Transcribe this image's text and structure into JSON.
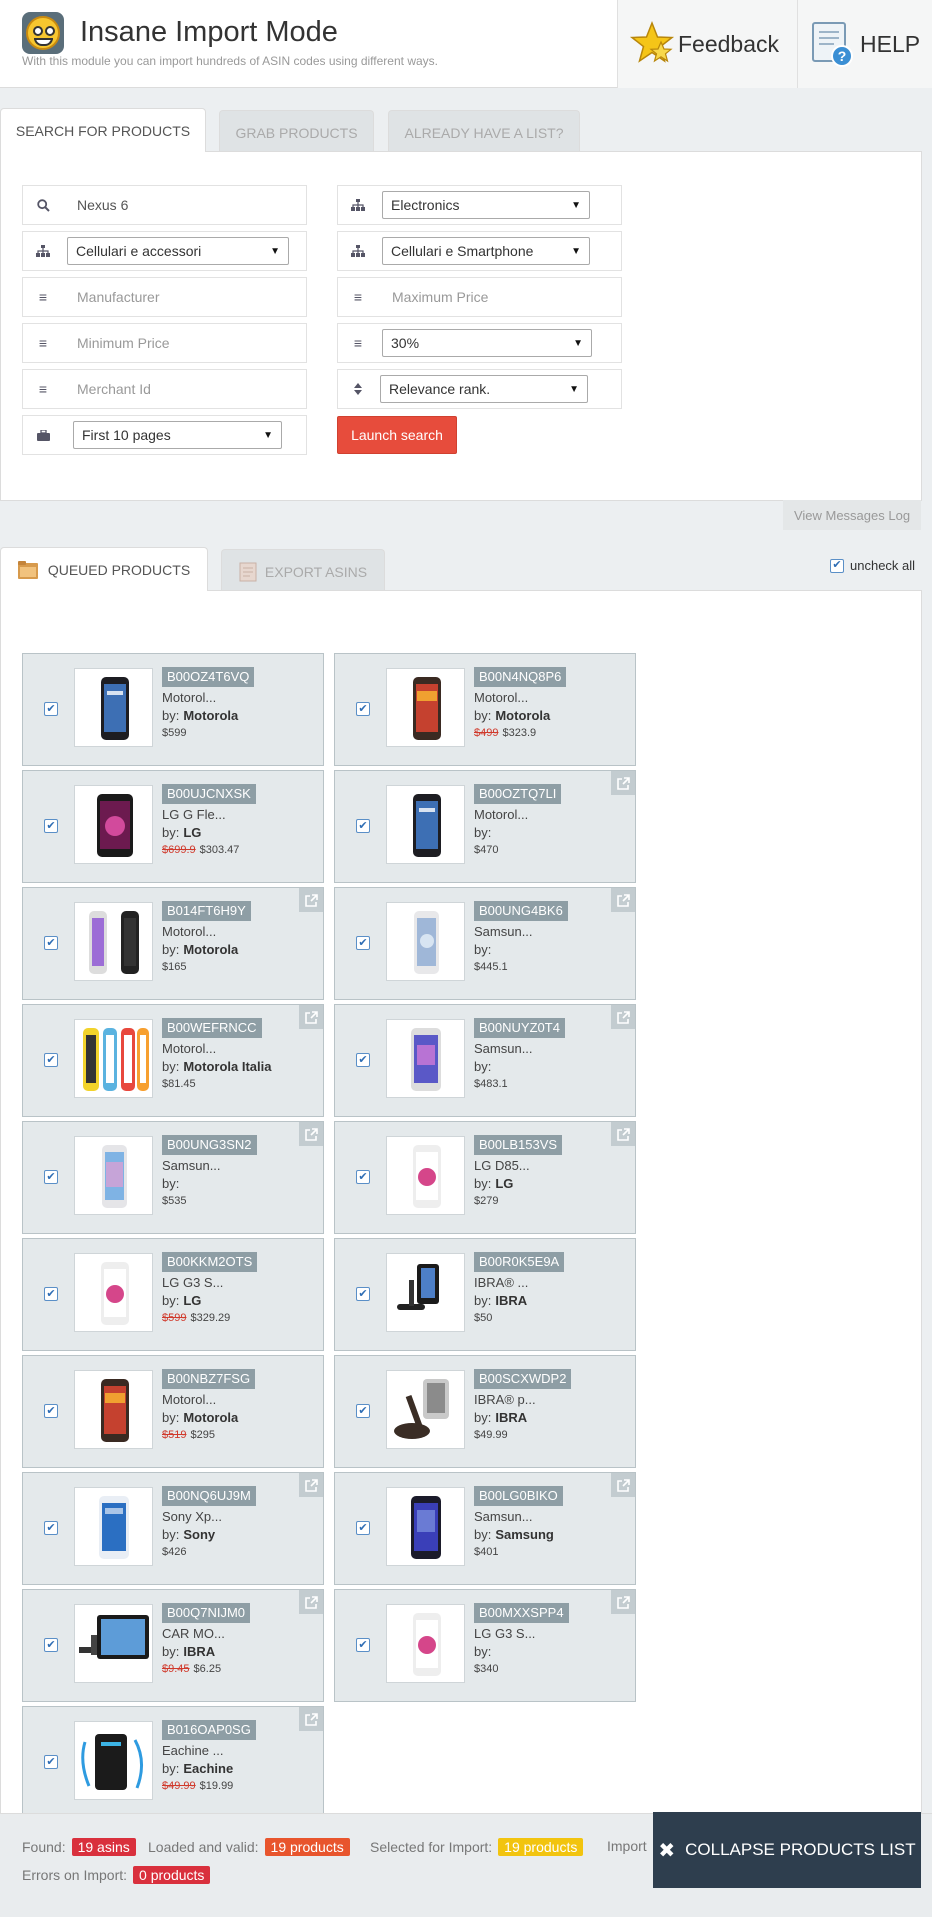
{
  "header": {
    "title": "Insane Import Mode",
    "subtitle": "With this module you can import hundreds of ASIN codes using different ways.",
    "feedback_label": "Feedback",
    "help_label": "HELP"
  },
  "search_tabs": [
    "SEARCH FOR PRODUCTS",
    "GRAB PRODUCTS",
    "ALREADY HAVE A LIST?"
  ],
  "search_form": {
    "keyword_value": "Nexus 6",
    "category_value": "Electronics",
    "subcategory1_value": "Cellulari e accessori",
    "subcategory2_value": "Cellulari e Smartphone",
    "manufacturer_placeholder": "Manufacturer",
    "max_price_placeholder": "Maximum Price",
    "min_price_placeholder": "Minimum Price",
    "discount_value": "30%",
    "merchant_placeholder": "Merchant Id",
    "sort_value": "Relevance rank.",
    "pages_value": "First 10 pages",
    "launch_label": "Launch search"
  },
  "view_messages_log": "View Messages Log",
  "products_tabs": [
    "QUEUED PRODUCTS",
    "EXPORT ASINS"
  ],
  "uncheck_all_label": "uncheck all",
  "products": [
    {
      "asin": "B00OZ4T6VQ",
      "name": "Motorol...",
      "brand": "Motorola",
      "old_price": "",
      "price": "$599",
      "img": "phone-nexus",
      "ext": false
    },
    {
      "asin": "B00N4NQ8P6",
      "name": "Motorol...",
      "brand": "Motorola",
      "old_price": "$499",
      "price": "$323.9",
      "img": "phone-moto-red",
      "ext": false
    },
    {
      "asin": "B00UJCNXSK",
      "name": "LG G Fle...",
      "brand": "LG",
      "old_price": "$699.9",
      "price": "$303.47",
      "img": "phone-lg-pink",
      "ext": false
    },
    {
      "asin": "B00OZTQ7LI",
      "name": "Motorol...",
      "brand": "",
      "old_price": "",
      "price": "$470",
      "img": "phone-nexus",
      "ext": true
    },
    {
      "asin": "B014FT6H9Y",
      "name": "Motorol...",
      "brand": "Motorola",
      "old_price": "",
      "price": "$165",
      "img": "phone-moto-pair",
      "ext": true
    },
    {
      "asin": "B00UNG4BK6",
      "name": "Samsun...",
      "brand": "",
      "old_price": "",
      "price": "$445.1",
      "img": "phone-samsung-white",
      "ext": true
    },
    {
      "asin": "B00WEFRNCC",
      "name": "Motorol...",
      "brand": "Motorola Italia",
      "old_price": "",
      "price": "$81.45",
      "img": "phone-moto-colors",
      "ext": true
    },
    {
      "asin": "B00NUYZ0T4",
      "name": "Samsun...",
      "brand": "",
      "old_price": "",
      "price": "$483.1",
      "img": "phone-samsung-note",
      "ext": true
    },
    {
      "asin": "B00UNG3SN2",
      "name": "Samsun...",
      "brand": "",
      "old_price": "",
      "price": "$535",
      "img": "phone-samsung-edge",
      "ext": true
    },
    {
      "asin": "B00LB153VS",
      "name": "LG D85...",
      "brand": "LG",
      "old_price": "",
      "price": "$279",
      "img": "phone-lg-white",
      "ext": true
    },
    {
      "asin": "B00KKM2OTS",
      "name": "LG G3 S...",
      "brand": "LG",
      "old_price": "$599",
      "price": "$329.29",
      "img": "phone-lg-white",
      "ext": false
    },
    {
      "asin": "B00R0K5E9A",
      "name": "IBRA® ...",
      "brand": "IBRA",
      "old_price": "",
      "price": "$50",
      "img": "car-holder",
      "ext": false
    },
    {
      "asin": "B00NBZ7FSG",
      "name": "Motorol...",
      "brand": "Motorola",
      "old_price": "$519",
      "price": "$295",
      "img": "phone-moto-red",
      "ext": false
    },
    {
      "asin": "B00SCXWDP2",
      "name": "IBRA® p...",
      "brand": "IBRA",
      "old_price": "",
      "price": "$49.99",
      "img": "car-holder-2",
      "ext": false
    },
    {
      "asin": "B00NQ6UJ9M",
      "name": "Sony Xp...",
      "brand": "Sony",
      "old_price": "",
      "price": "$426",
      "img": "phone-sony",
      "ext": true
    },
    {
      "asin": "B00LG0BIKO",
      "name": "Samsun...",
      "brand": "Samsung",
      "old_price": "",
      "price": "$401",
      "img": "phone-samsung-s5",
      "ext": true
    },
    {
      "asin": "B00Q7NIJM0",
      "name": "CAR MO...",
      "brand": "IBRA",
      "old_price": "$9.45",
      "price": "$6.25",
      "img": "tablet-mount",
      "ext": true
    },
    {
      "asin": "B00MXXSPP4",
      "name": "LG G3 S...",
      "brand": "",
      "old_price": "",
      "price": "$340",
      "img": "phone-lg-white",
      "ext": true
    },
    {
      "asin": "B016OAP0SG",
      "name": "Eachine ...",
      "brand": "Eachine",
      "old_price": "$49.99",
      "price": "$19.99",
      "img": "power-bank",
      "ext": true
    }
  ],
  "by_label": "by:",
  "footer": {
    "found_label": "Found:",
    "found_value": "19 asins",
    "loaded_label": "Loaded and valid:",
    "loaded_value": "19 products",
    "selected_label": "Selected for Import:",
    "selected_value": "19 products",
    "imported_label": "Import",
    "errors_label": "Errors on Import:",
    "errors_value": "0 products",
    "collapse_label": "COLLAPSE PRODUCTS LIST"
  },
  "colors": {
    "launch_button": "#e74c3c",
    "asin_badge": "#8e9ea5",
    "collapse_button": "#2e3e4e",
    "badge_red": "#d9303d",
    "badge_orange": "#e8552d",
    "badge_yellow": "#f2c40f"
  }
}
